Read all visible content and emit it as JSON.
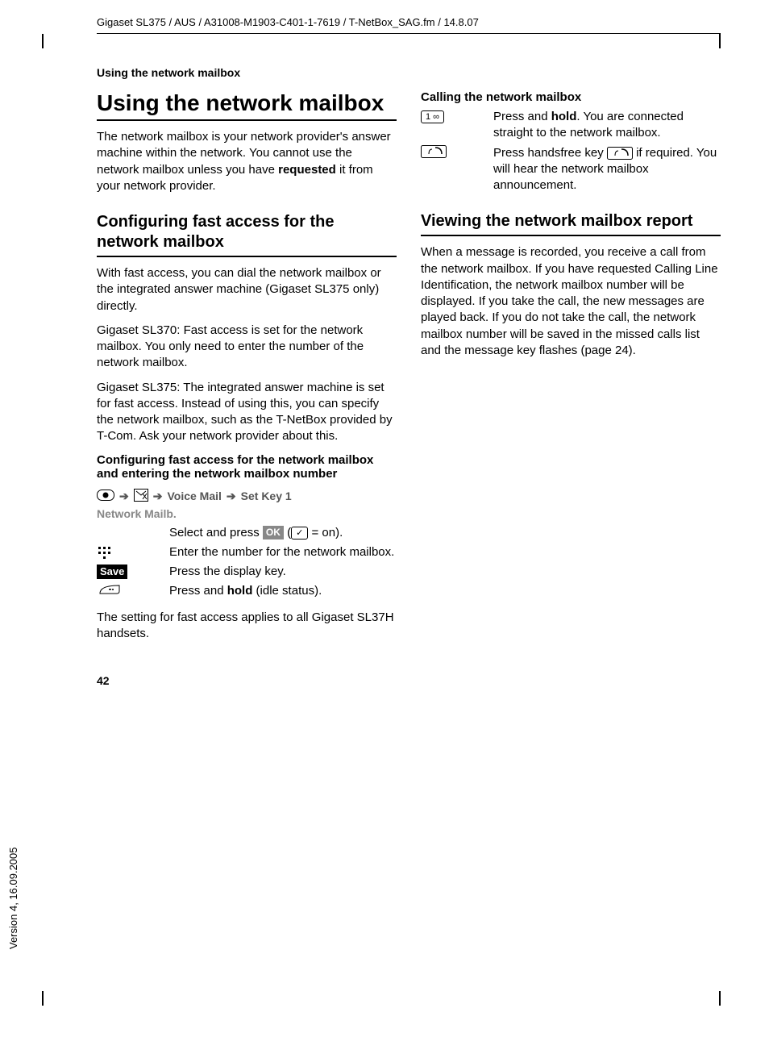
{
  "header_path": "Gigaset SL375 / AUS / A31008-M1903-C401-1-7619 / T-NetBox_SAG.fm / 14.8.07",
  "section_label": "Using the network mailbox",
  "h1": "Using the network mailbox",
  "intro_p1_a": "The network mailbox is your network provider's answer machine within the network. You cannot use the network mailbox unless you have ",
  "intro_p1_bold": "requested",
  "intro_p1_b": " it from your network provider.",
  "h2_config": "Configuring fast access for the network mailbox",
  "config_p1": "With fast access, you can dial the network mailbox or the integrated answer machine (Gigaset SL375 only) directly.",
  "config_p2": "Gigaset SL370: Fast access is set for the network mailbox. You only need to enter the number of the network mailbox.",
  "config_p3": "Gigaset SL375: The integrated answer machine is set for fast access. Instead of using this, you can specify the network mailbox, such as the T-NetBox provided by T-Com. Ask your network provider about this.",
  "h3_config_sub": "Configuring fast access for the network mailbox and entering the network mailbox number",
  "menu": {
    "voice_mail": "Voice Mail",
    "set_key": "Set Key 1"
  },
  "grey_label": "Network Mailb.",
  "step_select_a": "Select and press ",
  "step_select_ok": "OK",
  "step_select_b": " (",
  "step_select_c": " = on).",
  "step_enter": "Enter the number for the network mailbox.",
  "save_label": "Save",
  "step_save": "Press the display key.",
  "step_hold_a": "Press and ",
  "step_hold_bold": "hold",
  "step_hold_b": " (idle status).",
  "config_p4": "The setting for fast access applies to all Gigaset SL37H handsets.",
  "h3_calling": "Calling the network mailbox",
  "call_row1_a": "Press and ",
  "call_row1_bold": "hold",
  "call_row1_b": ". You are connected straight to the network mailbox.",
  "call_row2_a": "Press handsfree key ",
  "call_row2_b": " if required. You will hear the network mailbox announcement.",
  "h2_view": "Viewing the network mailbox report",
  "view_p1": "When a message is recorded, you receive a call from the network mailbox. If you have requested Calling Line Identification, the network mailbox number will be displayed. If you take the call, the new messages are played back. If you do not take the call, the network mailbox number will be saved in the missed calls list and the message key flashes (page 24).",
  "page_number": "42",
  "version": "Version 4, 16.09.2005"
}
